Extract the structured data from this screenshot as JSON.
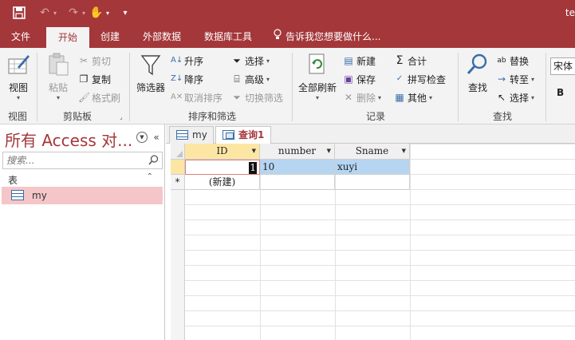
{
  "title": {
    "app_text": "te"
  },
  "tabs": [
    "文件",
    "开始",
    "创建",
    "外部数据",
    "数据库工具"
  ],
  "tell_me": "告诉我您想要做什么...",
  "ribbon": {
    "view": {
      "label": "视图",
      "group": "视图"
    },
    "clipboard": {
      "paste": "粘贴",
      "cut": "剪切",
      "copy": "复制",
      "format_painter": "格式刷",
      "group": "剪贴板"
    },
    "sort_filter": {
      "filter": "筛选器",
      "ascending": "升序",
      "descending": "降序",
      "remove_sort": "取消排序",
      "selection": "选择",
      "advanced": "高级",
      "toggle_filter": "切换筛选",
      "group": "排序和筛选"
    },
    "records": {
      "refresh_all": "全部刷新",
      "new": "新建",
      "save": "保存",
      "delete": "删除",
      "totals": "合计",
      "spelling": "拼写检查",
      "more": "其他",
      "group": "记录"
    },
    "find": {
      "find": "查找",
      "replace": "替换",
      "goto": "转至",
      "select": "选择",
      "group": "查找"
    },
    "font": {
      "name": "宋体",
      "bold": "B"
    }
  },
  "nav": {
    "title": "所有 Access 对...",
    "search_placeholder": "搜索...",
    "section": "表",
    "items": [
      "my"
    ]
  },
  "doc_tabs": [
    "my",
    "查询1"
  ],
  "datasheet": {
    "columns": [
      "ID",
      "number",
      "Sname"
    ],
    "rows": [
      {
        "ID": "1",
        "number": "10",
        "Sname": "xuyi"
      }
    ],
    "new_row_label": "(新建)",
    "new_row_marker": "*"
  }
}
